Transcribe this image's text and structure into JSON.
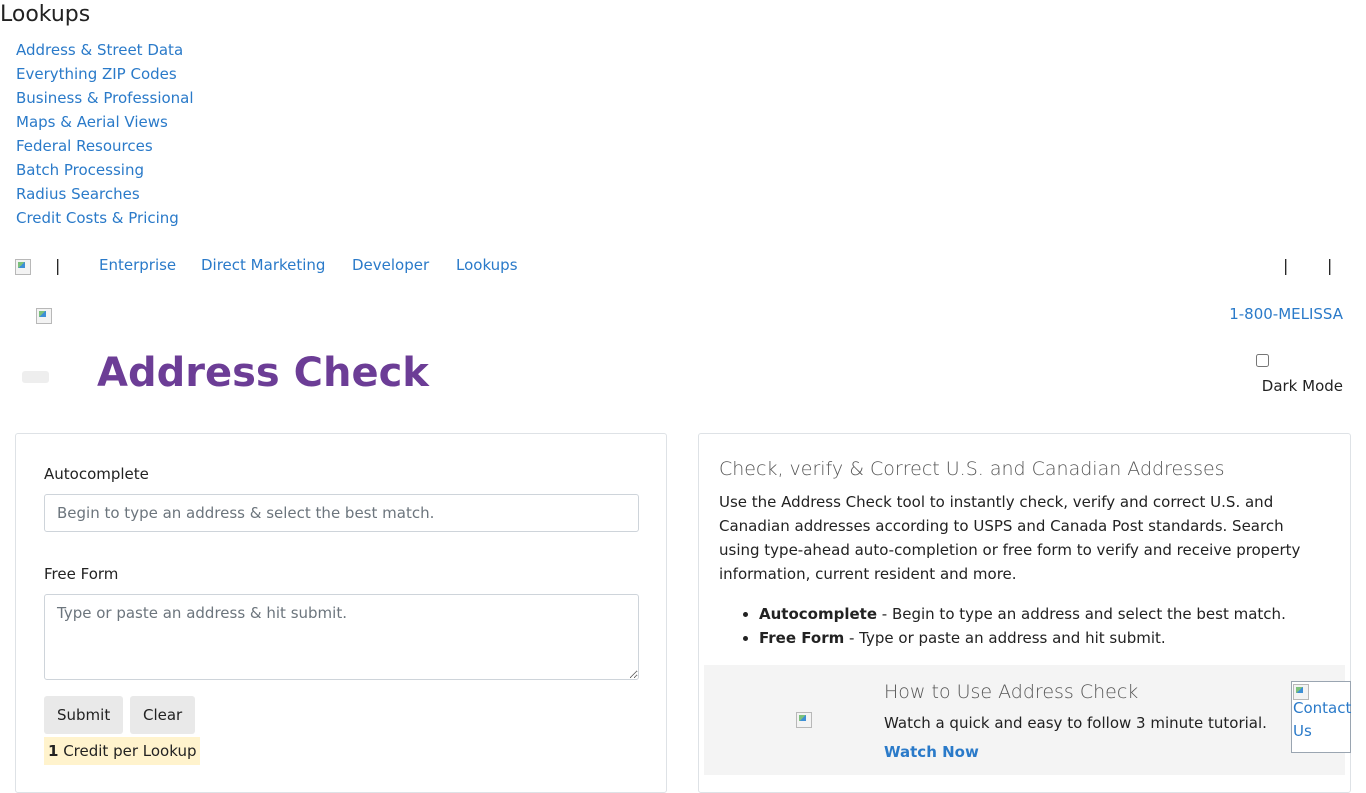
{
  "lookups_menu": {
    "title": "Lookups",
    "items": [
      {
        "label": "Address & Street Data"
      },
      {
        "label": "Everything ZIP Codes"
      },
      {
        "label": "Business & Professional"
      },
      {
        "label": "Maps & Aerial Views"
      },
      {
        "label": "Federal Resources"
      },
      {
        "label": "Batch Processing"
      },
      {
        "label": "Radius Searches"
      },
      {
        "label": "Credit Costs & Pricing"
      }
    ]
  },
  "navbar": {
    "separator": "|",
    "links": [
      {
        "label": "Enterprise"
      },
      {
        "label": "Direct Marketing"
      },
      {
        "label": "Developer"
      },
      {
        "label": "Lookups"
      }
    ],
    "phone": "1-800-MELISSA"
  },
  "header": {
    "title": "Address Check",
    "dark_mode_label": "Dark Mode"
  },
  "form": {
    "autocomplete_label": "Autocomplete",
    "autocomplete_placeholder": "Begin to type an address & select the best match.",
    "freeform_label": "Free Form",
    "freeform_placeholder": "Type or paste an address & hit submit.",
    "submit_label": "Submit",
    "clear_label": "Clear",
    "credit_count": "1",
    "credit_text": " Credit per Lookup"
  },
  "info": {
    "heading": "Check, verify & Correct U.S. and Canadian Addresses",
    "paragraph": "Use the Address Check tool to instantly check, verify and correct U.S. and Canadian addresses according to USPS and Canada Post standards. Search using type-ahead auto-completion or free form to verify and receive property information, current resident and more.",
    "bullets": [
      {
        "term": "Autocomplete",
        "text": " - Begin to type an address and select the best match."
      },
      {
        "term": "Free Form",
        "text": " - Type or paste an address and hit submit."
      }
    ]
  },
  "tutorial": {
    "heading": "How to Use Address Check",
    "text": "Watch a quick and easy to follow 3 minute tutorial.",
    "link": "Watch Now"
  },
  "contact": {
    "line1": "Contact",
    "line2": "Us"
  },
  "colors": {
    "link": "#2a7ac9",
    "title": "#6c3d96",
    "credit_bg": "#fff3cd",
    "tutorial_bg": "#f4f4f4"
  }
}
